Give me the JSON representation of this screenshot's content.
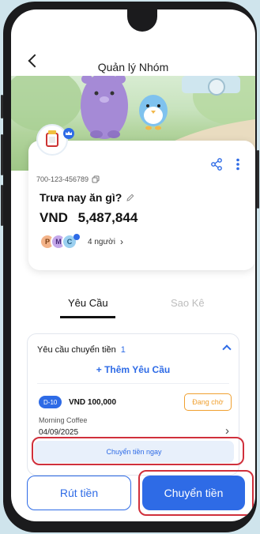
{
  "header": {
    "title": "Quản lý Nhóm"
  },
  "group": {
    "account_number": "700-123-456789",
    "name": "Trưa nay ăn gì?",
    "currency": "VND",
    "balance": "5,487,844",
    "member_initials": [
      "P",
      "M",
      "C"
    ],
    "member_count": "4 người"
  },
  "tabs": [
    {
      "label": "Yêu Cầu",
      "active": true
    },
    {
      "label": "Sao Kê",
      "active": false
    }
  ],
  "requests": {
    "title": "Yêu cầu chuyển tiền",
    "count": "1",
    "add_label": "+ Thêm Yêu Cầu",
    "items": [
      {
        "badge": "D-10",
        "amount": "VND 100,000",
        "status": "Đang chờ",
        "note": "Morning Coffee",
        "date": "04/09/2025",
        "action_label": "Chuyển tiền ngay"
      }
    ]
  },
  "actions": {
    "withdraw_label": "Rút tiền",
    "transfer_label": "Chuyển tiền"
  },
  "colors": {
    "accent": "#2e6be6",
    "pending": "#f0a030",
    "highlight": "#d0303c",
    "badge": "#2e6be6"
  },
  "icons": [
    "back-chevron-icon",
    "copy-icon",
    "edit-pencil-icon",
    "share-icon",
    "more-vertical-icon",
    "chevron-right-icon",
    "chevron-up-icon",
    "crown-icon"
  ]
}
